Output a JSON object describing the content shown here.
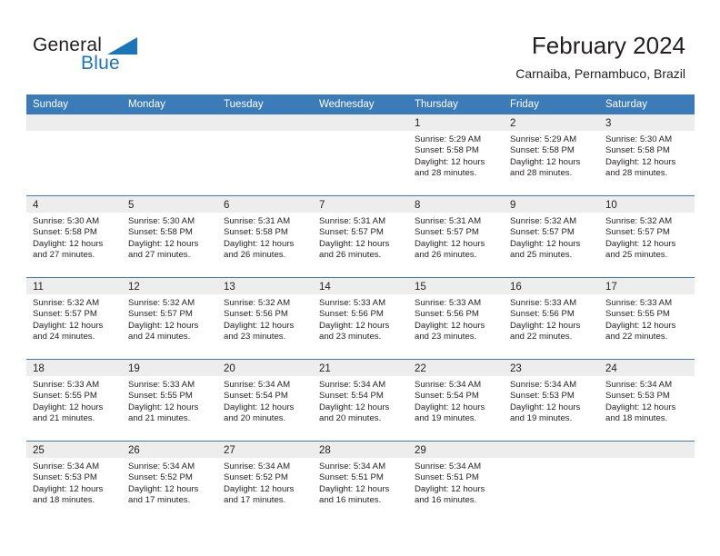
{
  "branding": {
    "logo_text_primary": "General",
    "logo_text_secondary": "Blue",
    "logo_accent_color": "#1b75bb"
  },
  "header": {
    "title": "February 2024",
    "subtitle": "Carnaiba, Pernambuco, Brazil"
  },
  "calendar": {
    "header_bg_color": "#3b7cb8",
    "daynum_band_color": "#ededed",
    "weekday_headers": [
      "Sunday",
      "Monday",
      "Tuesday",
      "Wednesday",
      "Thursday",
      "Friday",
      "Saturday"
    ],
    "weeks": [
      [
        {
          "day": "",
          "lines": []
        },
        {
          "day": "",
          "lines": []
        },
        {
          "day": "",
          "lines": []
        },
        {
          "day": "",
          "lines": []
        },
        {
          "day": "1",
          "lines": [
            "Sunrise: 5:29 AM",
            "Sunset: 5:58 PM",
            "Daylight: 12 hours",
            "and 28 minutes."
          ]
        },
        {
          "day": "2",
          "lines": [
            "Sunrise: 5:29 AM",
            "Sunset: 5:58 PM",
            "Daylight: 12 hours",
            "and 28 minutes."
          ]
        },
        {
          "day": "3",
          "lines": [
            "Sunrise: 5:30 AM",
            "Sunset: 5:58 PM",
            "Daylight: 12 hours",
            "and 28 minutes."
          ]
        }
      ],
      [
        {
          "day": "4",
          "lines": [
            "Sunrise: 5:30 AM",
            "Sunset: 5:58 PM",
            "Daylight: 12 hours",
            "and 27 minutes."
          ]
        },
        {
          "day": "5",
          "lines": [
            "Sunrise: 5:30 AM",
            "Sunset: 5:58 PM",
            "Daylight: 12 hours",
            "and 27 minutes."
          ]
        },
        {
          "day": "6",
          "lines": [
            "Sunrise: 5:31 AM",
            "Sunset: 5:58 PM",
            "Daylight: 12 hours",
            "and 26 minutes."
          ]
        },
        {
          "day": "7",
          "lines": [
            "Sunrise: 5:31 AM",
            "Sunset: 5:57 PM",
            "Daylight: 12 hours",
            "and 26 minutes."
          ]
        },
        {
          "day": "8",
          "lines": [
            "Sunrise: 5:31 AM",
            "Sunset: 5:57 PM",
            "Daylight: 12 hours",
            "and 26 minutes."
          ]
        },
        {
          "day": "9",
          "lines": [
            "Sunrise: 5:32 AM",
            "Sunset: 5:57 PM",
            "Daylight: 12 hours",
            "and 25 minutes."
          ]
        },
        {
          "day": "10",
          "lines": [
            "Sunrise: 5:32 AM",
            "Sunset: 5:57 PM",
            "Daylight: 12 hours",
            "and 25 minutes."
          ]
        }
      ],
      [
        {
          "day": "11",
          "lines": [
            "Sunrise: 5:32 AM",
            "Sunset: 5:57 PM",
            "Daylight: 12 hours",
            "and 24 minutes."
          ]
        },
        {
          "day": "12",
          "lines": [
            "Sunrise: 5:32 AM",
            "Sunset: 5:57 PM",
            "Daylight: 12 hours",
            "and 24 minutes."
          ]
        },
        {
          "day": "13",
          "lines": [
            "Sunrise: 5:32 AM",
            "Sunset: 5:56 PM",
            "Daylight: 12 hours",
            "and 23 minutes."
          ]
        },
        {
          "day": "14",
          "lines": [
            "Sunrise: 5:33 AM",
            "Sunset: 5:56 PM",
            "Daylight: 12 hours",
            "and 23 minutes."
          ]
        },
        {
          "day": "15",
          "lines": [
            "Sunrise: 5:33 AM",
            "Sunset: 5:56 PM",
            "Daylight: 12 hours",
            "and 23 minutes."
          ]
        },
        {
          "day": "16",
          "lines": [
            "Sunrise: 5:33 AM",
            "Sunset: 5:56 PM",
            "Daylight: 12 hours",
            "and 22 minutes."
          ]
        },
        {
          "day": "17",
          "lines": [
            "Sunrise: 5:33 AM",
            "Sunset: 5:55 PM",
            "Daylight: 12 hours",
            "and 22 minutes."
          ]
        }
      ],
      [
        {
          "day": "18",
          "lines": [
            "Sunrise: 5:33 AM",
            "Sunset: 5:55 PM",
            "Daylight: 12 hours",
            "and 21 minutes."
          ]
        },
        {
          "day": "19",
          "lines": [
            "Sunrise: 5:33 AM",
            "Sunset: 5:55 PM",
            "Daylight: 12 hours",
            "and 21 minutes."
          ]
        },
        {
          "day": "20",
          "lines": [
            "Sunrise: 5:34 AM",
            "Sunset: 5:54 PM",
            "Daylight: 12 hours",
            "and 20 minutes."
          ]
        },
        {
          "day": "21",
          "lines": [
            "Sunrise: 5:34 AM",
            "Sunset: 5:54 PM",
            "Daylight: 12 hours",
            "and 20 minutes."
          ]
        },
        {
          "day": "22",
          "lines": [
            "Sunrise: 5:34 AM",
            "Sunset: 5:54 PM",
            "Daylight: 12 hours",
            "and 19 minutes."
          ]
        },
        {
          "day": "23",
          "lines": [
            "Sunrise: 5:34 AM",
            "Sunset: 5:53 PM",
            "Daylight: 12 hours",
            "and 19 minutes."
          ]
        },
        {
          "day": "24",
          "lines": [
            "Sunrise: 5:34 AM",
            "Sunset: 5:53 PM",
            "Daylight: 12 hours",
            "and 18 minutes."
          ]
        }
      ],
      [
        {
          "day": "25",
          "lines": [
            "Sunrise: 5:34 AM",
            "Sunset: 5:53 PM",
            "Daylight: 12 hours",
            "and 18 minutes."
          ]
        },
        {
          "day": "26",
          "lines": [
            "Sunrise: 5:34 AM",
            "Sunset: 5:52 PM",
            "Daylight: 12 hours",
            "and 17 minutes."
          ]
        },
        {
          "day": "27",
          "lines": [
            "Sunrise: 5:34 AM",
            "Sunset: 5:52 PM",
            "Daylight: 12 hours",
            "and 17 minutes."
          ]
        },
        {
          "day": "28",
          "lines": [
            "Sunrise: 5:34 AM",
            "Sunset: 5:51 PM",
            "Daylight: 12 hours",
            "and 16 minutes."
          ]
        },
        {
          "day": "29",
          "lines": [
            "Sunrise: 5:34 AM",
            "Sunset: 5:51 PM",
            "Daylight: 12 hours",
            "and 16 minutes."
          ]
        },
        {
          "day": "",
          "lines": []
        },
        {
          "day": "",
          "lines": []
        }
      ]
    ]
  }
}
